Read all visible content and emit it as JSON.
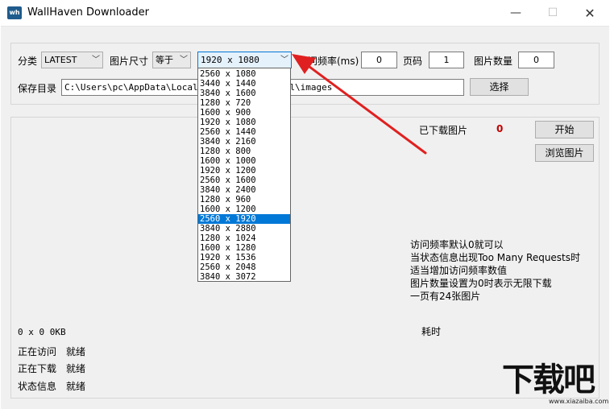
{
  "window": {
    "title": "WallHaven Downloader",
    "icon_text": "wh",
    "minimize_glyph": "—",
    "maximize_glyph": "☐",
    "close_glyph": "✕"
  },
  "controls": {
    "category_label": "分类",
    "category_value": "LATEST",
    "size_label": "图片尺寸",
    "size_op_value": "等于",
    "size_value": "1920 x 1080",
    "freq_label": "访问频率(ms)",
    "freq_value": "0",
    "page_label": "页码",
    "page_value": "1",
    "count_label": "图片数量",
    "count_value": "0",
    "save_label": "保存目录",
    "save_path": "C:\\Users\\pc\\AppData\\Local\\Te",
    "save_path_tail": "l\\images",
    "choose_button": "选择"
  },
  "resolution_options": [
    "2560 x 1080",
    "3440 x 1440",
    "3840 x 1600",
    "1280 x 720",
    "1600 x 900",
    "1920 x 1080",
    "2560 x 1440",
    "3840 x 2160",
    "1280 x 800",
    "1600 x 1000",
    "1920 x 1200",
    "2560 x 1600",
    "3840 x 2400",
    "1280 x 960",
    "1600 x 1200",
    "2560 x 1920",
    "3840 x 2880",
    "1280 x 1024",
    "1600 x 1280",
    "1920 x 1536",
    "2560 x 2048",
    "3840 x 3072"
  ],
  "resolution_selected_index": 15,
  "status": {
    "downloaded_label": "已下载图片",
    "downloaded_count": "0",
    "start_button": "开始",
    "browse_button": "浏览图片",
    "hints": [
      "访问频率默认0就可以",
      "当状态信息出现Too Many Requests时",
      "适当增加访问频率数值",
      "图片数量设置为0时表示无限下载",
      "一页有24张图片"
    ],
    "elapsed_label": "耗时",
    "size_info": "0 x 0 0KB",
    "visiting_label": "正在访问",
    "visiting_value": "就绪",
    "downloading_label": "正在下载",
    "downloading_value": "就绪",
    "state_label": "状态信息",
    "state_value": "就绪"
  },
  "watermark": {
    "text": "下载吧",
    "url": "www.xiazaiba.com"
  },
  "colors": {
    "accent": "#0078d7",
    "count_red": "#c00000",
    "arrow_red": "#e02020"
  }
}
